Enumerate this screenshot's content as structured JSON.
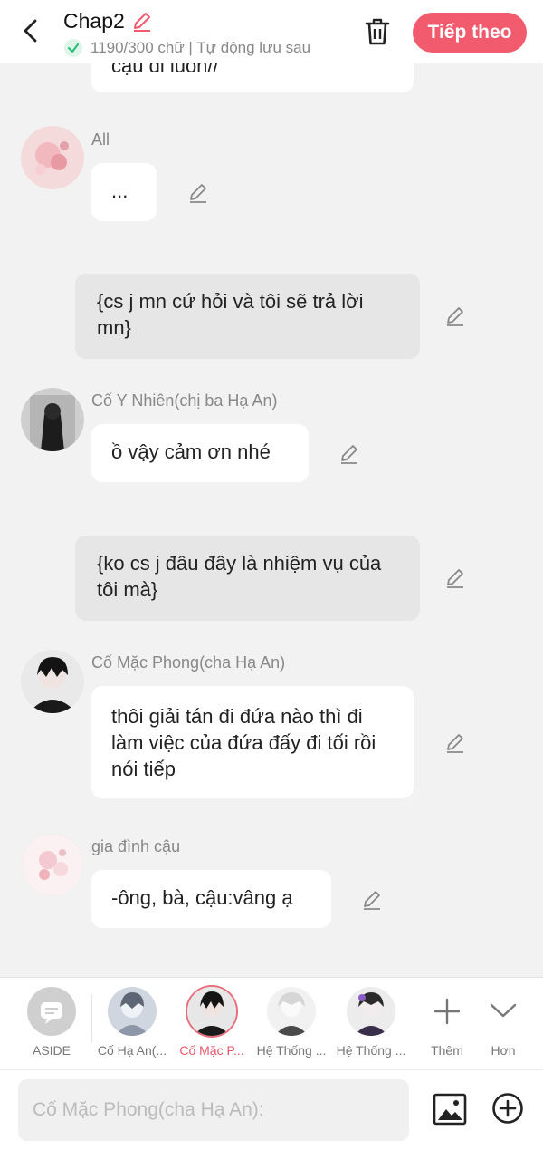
{
  "header": {
    "title": "Chap2",
    "status": "1190/300 chữ | Tự động lưu sau",
    "next_label": "Tiếp theo"
  },
  "messages": {
    "m0": {
      "text": "cậu đi luôn//"
    },
    "m1": {
      "name": "All",
      "text": "..."
    },
    "m2": {
      "text": "{cs j mn cứ hỏi và tôi sẽ trả lời mn}"
    },
    "m3": {
      "name": "Cố Y Nhiên(chị ba Hạ An)",
      "text": "ồ vậy cảm ơn nhé"
    },
    "m4": {
      "text": "{ko cs j đâu đây là nhiệm vụ của tôi mà}"
    },
    "m5": {
      "name": "Cố Mặc Phong(cha Hạ An)",
      "text": "thôi giải tán đi đứa nào thì đi làm việc của đứa đấy đi tối rồi nói tiếp"
    },
    "m6": {
      "name": "gia đình cậu",
      "text": "-ông, bà, cậu:vâng ạ"
    }
  },
  "characters": [
    {
      "label": "ASIDE"
    },
    {
      "label": "Cố Hạ An(..."
    },
    {
      "label": "Cố Mặc P..."
    },
    {
      "label": "Hệ Thống ..."
    },
    {
      "label": "Hệ Thống ..."
    },
    {
      "label": "Thêm"
    },
    {
      "label": "Hơn"
    }
  ],
  "input": {
    "placeholder": "Cố Mặc Phong(cha Hạ An):"
  },
  "colors": {
    "accent": "#f25a6e",
    "selected_label": "#e8566c",
    "status_check": "#2ec07a"
  },
  "icons": [
    "back-arrow-icon",
    "pencil-icon",
    "check-circle-icon",
    "trash-icon",
    "chat-bubble-icon",
    "plus-icon",
    "chevron-down-icon",
    "image-icon",
    "plus-circle-icon"
  ]
}
